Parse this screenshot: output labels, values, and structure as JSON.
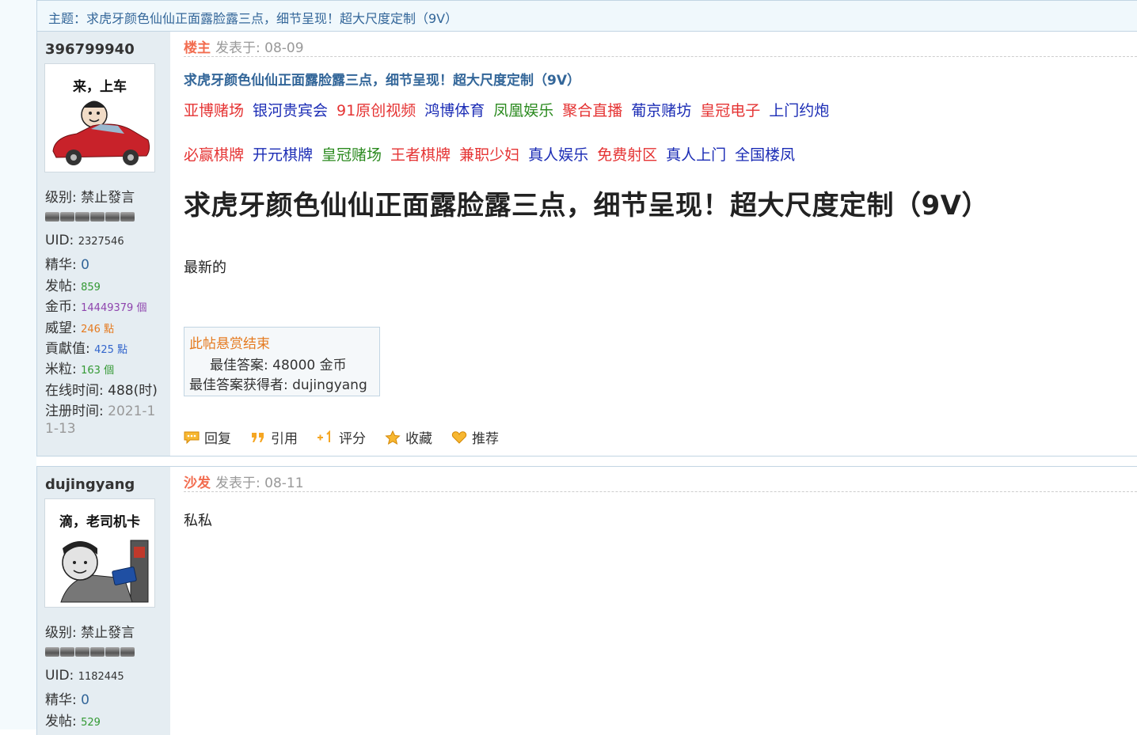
{
  "topic": {
    "label": "主题：求虎牙颜色仙仙正面露脸露三点，细节呈现！超大尺度定制（9V）"
  },
  "posts": [
    {
      "author": "396799940",
      "avatar_caption": "来，上车",
      "level_label": "级别:",
      "level_value": "禁止發言",
      "stats": {
        "uid_label": "UID:",
        "uid": "2327546",
        "digest_label": "精华:",
        "digest": "0",
        "posts_label": "发帖:",
        "posts": "859",
        "gold_label": "金币:",
        "gold": "14449379 個",
        "prestige_label": "威望:",
        "prestige": "246 點",
        "contrib_label": "貢獻值:",
        "contrib": "425 點",
        "rice_label": "米粒:",
        "rice": "163 個",
        "online_label": "在线时间:",
        "online": "488(时)",
        "reg_label": "注册时间:",
        "reg_a": "2021-1",
        "reg_b": "1-13"
      },
      "floor": "楼主",
      "posted": "发表于: 08-09",
      "subtitle": "求虎牙颜色仙仙正面露脸露三点，细节呈现！超大尺度定制（9V）",
      "ad_row1": [
        "亚博赌场",
        "银河贵宾会",
        "91原创视频",
        "鸿博体育",
        "凤凰娱乐",
        "聚合直播",
        "葡京赌坊",
        "皇冠电子",
        "上门约炮"
      ],
      "ad_row2": [
        "必赢棋牌",
        "开元棋牌",
        "皇冠赌场",
        "王者棋牌",
        "兼职少妇",
        "真人娱乐",
        "免费射区",
        "真人上门",
        "全国楼凤"
      ],
      "title": "求虎牙颜色仙仙正面露脸露三点，细节呈现！超大尺度定制（9V）",
      "body": "最新的",
      "reward": {
        "title": "此帖悬赏结束",
        "best_answer": "最佳答案: 48000 金币",
        "winner": "最佳答案获得者: dujingyang"
      },
      "actions": [
        "回复",
        "引用",
        "评分",
        "收藏",
        "推荐"
      ]
    },
    {
      "author": "dujingyang",
      "avatar_caption": "滴，老司机卡",
      "level_label": "级别:",
      "level_value": "禁止發言",
      "stats": {
        "uid_label": "UID:",
        "uid": "1182445",
        "digest_label": "精华:",
        "digest": "0",
        "posts_label": "发帖:",
        "posts": "529"
      },
      "floor": "沙发",
      "posted": "发表于: 08-11",
      "body": "私私"
    }
  ],
  "colors": {
    "link": "#336699",
    "floor": "#f26c4f",
    "border": "#c2d5e3",
    "author_bg": "#e5edf2"
  }
}
